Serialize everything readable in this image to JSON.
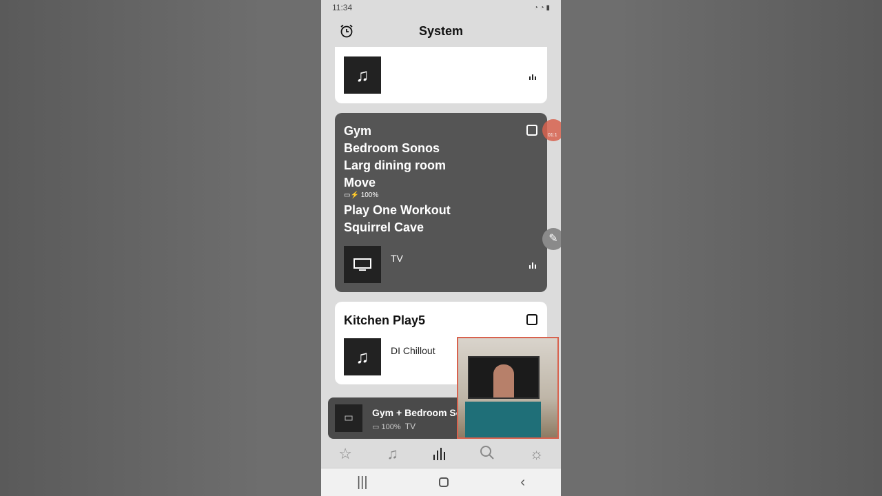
{
  "status_bar": {
    "time": "11:34"
  },
  "header": {
    "title": "System",
    "alarm_icon": "alarm-clock-icon"
  },
  "cards": [
    {
      "rooms": [],
      "source": "",
      "art_icon": "music-note-icon"
    },
    {
      "rooms": [
        "Gym",
        "Bedroom Sonos",
        "Larg dining room",
        "Move"
      ],
      "battery": "100%",
      "rooms_after": [
        "Play One Workout",
        "Squirrel Cave"
      ],
      "source": "TV",
      "art_icon": "tv-icon",
      "cast_icon": "airplay-icon"
    },
    {
      "rooms": [
        "Kitchen Play5"
      ],
      "source": "DI Chillout",
      "art_icon": "music-note-icon",
      "cast_icon": "airplay-icon"
    }
  ],
  "mini_player": {
    "title": "Gym + Bedroom So",
    "battery": "100%",
    "source": "TV"
  },
  "bottom_nav": [
    "favorites",
    "browse",
    "system",
    "search",
    "settings"
  ],
  "overlay": {
    "badge_text": "01:1"
  },
  "colors": {
    "dark_card": "#555555",
    "accent_overlay": "#d8624e"
  }
}
